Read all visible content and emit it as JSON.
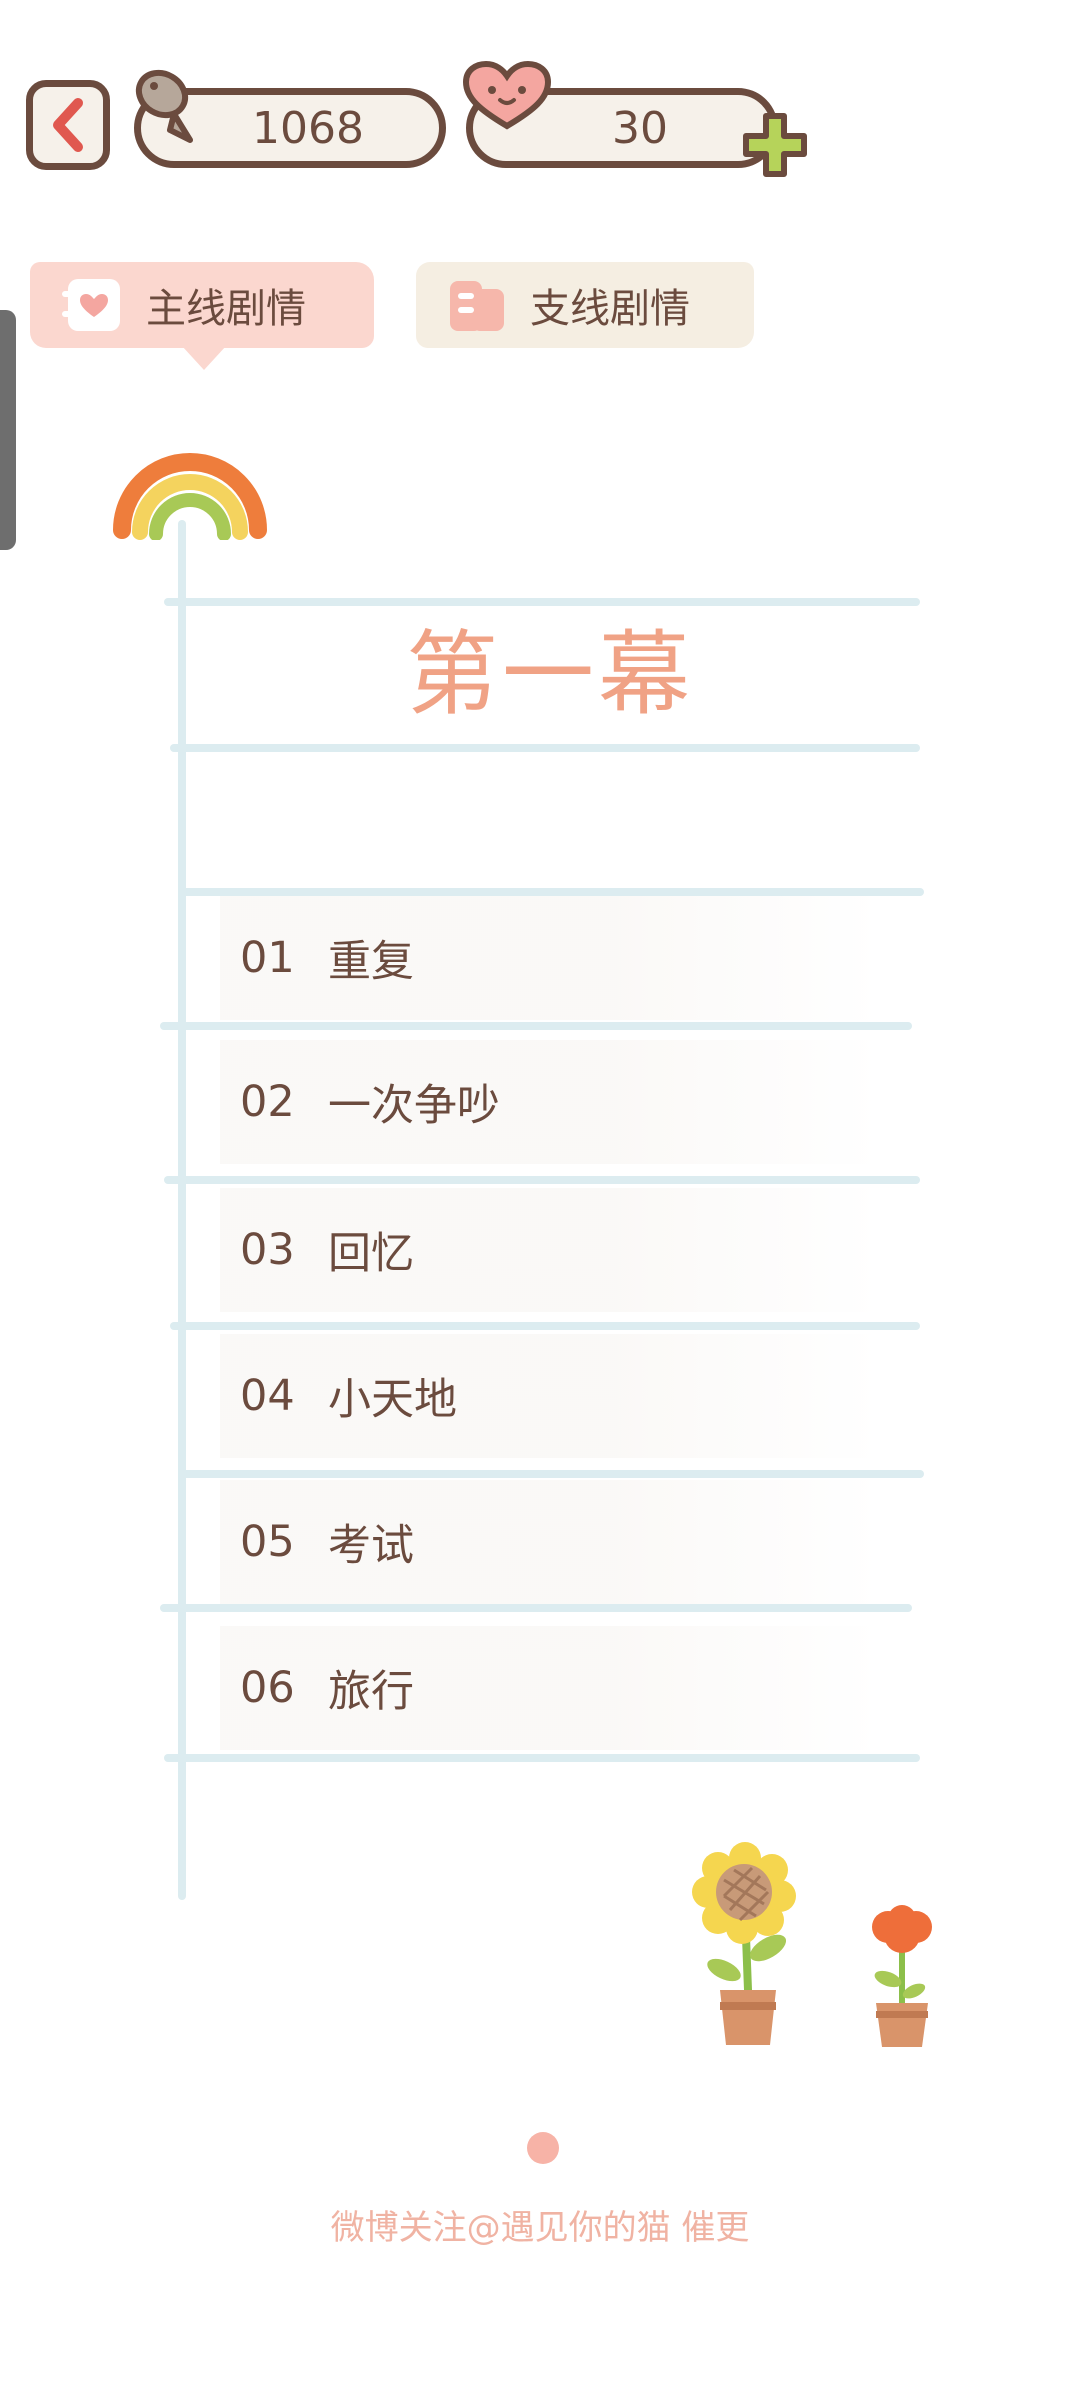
{
  "resources": {
    "fish_count": "1068",
    "heart_count": "30"
  },
  "tabs": [
    {
      "label": "主线剧情",
      "active": true
    },
    {
      "label": "支线剧情",
      "active": false
    }
  ],
  "act": {
    "title": "第一幕"
  },
  "chapters": [
    {
      "num": "01",
      "title": "重复"
    },
    {
      "num": "02",
      "title": "一次争吵"
    },
    {
      "num": "03",
      "title": "回忆"
    },
    {
      "num": "04",
      "title": "小天地"
    },
    {
      "num": "05",
      "title": "考试"
    },
    {
      "num": "06",
      "title": "旅行"
    }
  ],
  "footer": {
    "text": "微博关注@遇见你的猫 催更"
  },
  "colors": {
    "outline": "#6b4b3e",
    "accent_title": "#f0a285",
    "tab_active": "#fbd7cf",
    "tab_inactive": "#f5eee2",
    "line": "#dcecf0"
  }
}
